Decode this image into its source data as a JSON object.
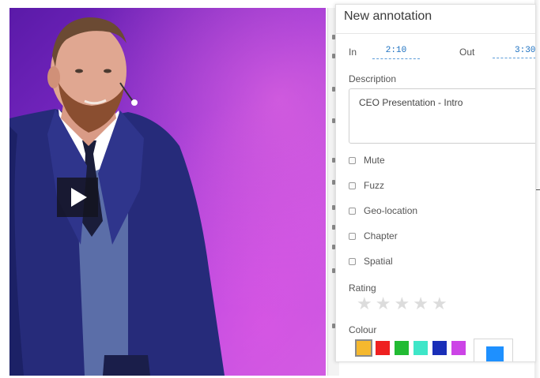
{
  "video": {
    "play_icon": "play-icon"
  },
  "panel": {
    "title": "New annotation",
    "in_label": "In",
    "in_value": "2:10",
    "out_label": "Out",
    "out_value": "3:30",
    "description_label": "Description",
    "description_value": "CEO Presentation - Intro",
    "checkboxes": [
      {
        "label": "Mute",
        "checked": false
      },
      {
        "label": "Fuzz",
        "checked": false
      },
      {
        "label": "Geo-location",
        "checked": false
      },
      {
        "label": "Chapter",
        "checked": false
      },
      {
        "label": "Spatial",
        "checked": false
      }
    ],
    "rating_label": "Rating",
    "rating_value": 0,
    "rating_max": 5,
    "colour_label": "Colour",
    "colours": [
      "#f5b82e",
      "#ee2020",
      "#22bb33",
      "#3ee6c8",
      "#1a2fb8",
      "#cc44e6"
    ],
    "selected_colour": "#f5b82e",
    "custom_colour": "#1e90ff"
  }
}
